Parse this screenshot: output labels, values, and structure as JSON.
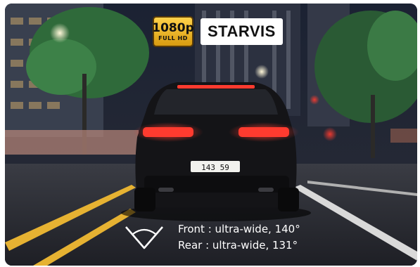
{
  "badges": {
    "resolution": "1080p",
    "resolution_sub": "FULL HD",
    "sensor": "STARVIS"
  },
  "plate": {
    "text": "143 59"
  },
  "specs": {
    "front": "Front : ultra-wide, 140°",
    "rear": "Rear : ultra-wide, 131°"
  },
  "icons": {
    "angle": "field-of-view-icon"
  },
  "colors": {
    "badge_gold": "#f2b632",
    "tail_light": "#ff3b2f",
    "text": "#ffffff"
  }
}
